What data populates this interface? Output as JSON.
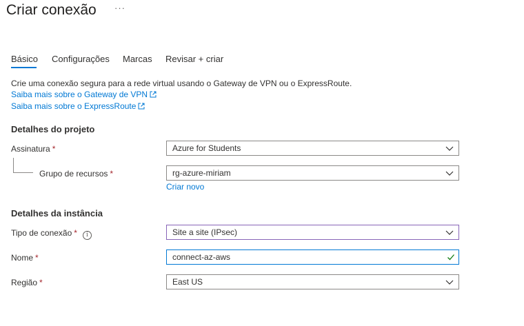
{
  "page": {
    "title": "Criar conexão",
    "more_label": "···"
  },
  "tabs": [
    {
      "label": "Básico",
      "active": true
    },
    {
      "label": "Configurações",
      "active": false
    },
    {
      "label": "Marcas",
      "active": false
    },
    {
      "label": "Revisar + criar",
      "active": false
    }
  ],
  "intro": {
    "description": "Crie uma conexão segura para a rede virtual usando o Gateway de VPN ou o ExpressRoute.",
    "link_vpn": "Saiba mais sobre o Gateway de VPN",
    "link_expressroute": "Saiba mais sobre o ExpressRoute"
  },
  "project": {
    "heading": "Detalhes do projeto",
    "subscription_label": "Assinatura",
    "subscription_value": "Azure for Students",
    "resource_group_label": "Grupo de recursos",
    "resource_group_value": "rg-azure-miriam",
    "create_new_link": "Criar novo"
  },
  "instance": {
    "heading": "Detalhes da instância",
    "connection_type_label": "Tipo de conexão",
    "connection_type_value": "Site a site (IPsec)",
    "name_label": "Nome",
    "name_value": "connect-az-aws",
    "region_label": "Região",
    "region_value": "East US"
  },
  "required_marker": "*",
  "info_glyph": "i",
  "colors": {
    "accent": "#0078d4",
    "required": "#a4262c",
    "focus_purple": "#8764b8",
    "valid_check": "#107c10"
  }
}
